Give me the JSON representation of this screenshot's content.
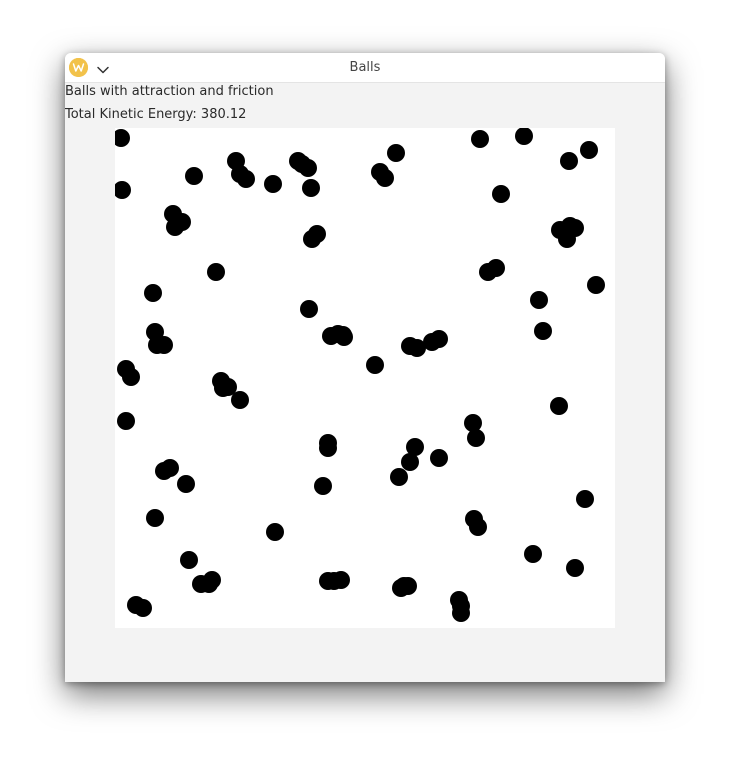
{
  "window": {
    "title": "Balls",
    "logo_icon": "app-logo-icon",
    "menu_icon": "chevron-down-icon"
  },
  "labels": {
    "description": "Balls with attraction and friction",
    "energy_text": "Total Kinetic Energy: 380.12"
  },
  "colors": {
    "ball": "#000000",
    "canvas_background": "#ffffff",
    "window_background": "#f3f3f3",
    "logo": "#f2c24a"
  },
  "simulation": {
    "total_kinetic_energy": 380.12,
    "ball_radius": 9,
    "ball_count": 88
  }
}
